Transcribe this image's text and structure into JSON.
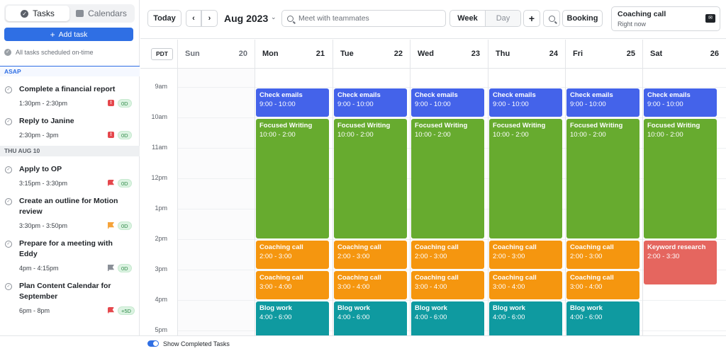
{
  "sidebar": {
    "tabs": [
      {
        "label": "Tasks",
        "icon": "check-circle-icon"
      },
      {
        "label": "Calendars",
        "icon": "calendar-icon"
      }
    ],
    "add_task": "Add task",
    "scheduled_status": "All tasks scheduled on-time",
    "sections": [
      {
        "heading": "ASAP"
      },
      {
        "heading": "THU AUG 10"
      }
    ],
    "tasks": [
      {
        "title": "Complete a financial report",
        "time": "1:30pm - 2:30pm",
        "flag": "red-exclaim",
        "badge": "0D"
      },
      {
        "title": "Reply to Janine",
        "time": "2:30pm - 3pm",
        "flag": "red-exclaim",
        "badge": "0D"
      },
      {
        "title": "Apply to OP",
        "time": "3:15pm - 3:30pm",
        "flag": "red",
        "badge": "0D"
      },
      {
        "title": "Create an outline for Motion review",
        "time": "3:30pm - 3:50pm",
        "flag": "orange",
        "badge": "0D"
      },
      {
        "title": "Prepare for a meeting with Eddy",
        "time": "4pm - 4:15pm",
        "flag": "gray",
        "badge": "0D"
      },
      {
        "title": "Plan Content Calendar for September",
        "time": "6pm - 8pm",
        "flag": "red",
        "badge": "+5D"
      }
    ]
  },
  "toolbar": {
    "today": "Today",
    "prev": "‹",
    "next": "›",
    "month": "Aug 2023",
    "search_placeholder": "Meet with teammates",
    "view_week": "Week",
    "view_day": "Day",
    "add": "+",
    "booking": "Booking"
  },
  "upcoming": {
    "title": "Coaching call",
    "subtitle": "Right now"
  },
  "calendar": {
    "timezone": "PDT",
    "days": [
      {
        "name": "Sun",
        "date": "20"
      },
      {
        "name": "Mon",
        "date": "21"
      },
      {
        "name": "Tue",
        "date": "22"
      },
      {
        "name": "Wed",
        "date": "23"
      },
      {
        "name": "Thu",
        "date": "24"
      },
      {
        "name": "Fri",
        "date": "25"
      },
      {
        "name": "Sat",
        "date": "26"
      }
    ],
    "hours": [
      "9am",
      "10am",
      "11am",
      "12pm",
      "1pm",
      "2pm",
      "3pm",
      "4pm",
      "5pm"
    ],
    "event_colors": {
      "blue": "#4463ea",
      "green": "#67ab2f",
      "orange": "#f5960f",
      "teal": "#0f9aa0",
      "salmon": "#e5665f"
    },
    "weekday_events": [
      {
        "title": "Check emails",
        "time": "9:00 - 10:00",
        "color": "blue"
      },
      {
        "title": "Focused Writing",
        "time": "10:00 - 2:00",
        "color": "green"
      },
      {
        "title": "Coaching call",
        "time": "2:00 - 3:00",
        "color": "orange"
      },
      {
        "title": "Coaching call",
        "time": "3:00 - 4:00",
        "color": "orange"
      },
      {
        "title": "Blog work",
        "time": "4:00 - 6:00",
        "color": "teal"
      }
    ],
    "saturday_events": [
      {
        "title": "Check emails",
        "time": "9:00 - 10:00",
        "color": "blue"
      },
      {
        "title": "Focused Writing",
        "time": "10:00 - 2:00",
        "color": "green"
      },
      {
        "title": "Keyword research",
        "time": "2:00 - 3:30",
        "color": "salmon"
      }
    ]
  },
  "footer": {
    "show_completed": "Show Completed Tasks"
  }
}
